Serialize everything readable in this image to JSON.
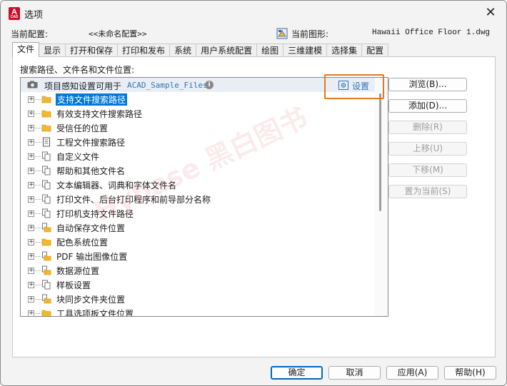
{
  "window": {
    "title": "选项",
    "close_glyph": "✕"
  },
  "app_icon": {
    "letter": "A",
    "sub": "CAD"
  },
  "profile": {
    "current_profile_label": "当前配置:",
    "current_profile_value": "<<未命名配置>>",
    "current_drawing_label": "当前图形:",
    "current_drawing_value": "Hawaii Office Floor 1.dwg"
  },
  "tabs": [
    {
      "label": "文件",
      "active": true
    },
    {
      "label": "显示"
    },
    {
      "label": "打开和保存"
    },
    {
      "label": "打印和发布"
    },
    {
      "label": "系统"
    },
    {
      "label": "用户系统配置"
    },
    {
      "label": "绘图"
    },
    {
      "label": "三维建模"
    },
    {
      "label": "选择集"
    },
    {
      "label": "配置"
    }
  ],
  "files_panel": {
    "section_label": "搜索路径、文件名和文件位置:",
    "project_header": {
      "text": "项目感知设置可用于",
      "path": "ACAD_Sample_Files",
      "info_glyph": "i",
      "settings_label": "设置"
    },
    "tree_items": [
      {
        "label": "支持文件搜索路径",
        "icon": "folder-icon",
        "selected": true
      },
      {
        "label": "有效支持文件搜索路径",
        "icon": "folder-icon"
      },
      {
        "label": "受信任的位置",
        "icon": "folder-icon"
      },
      {
        "label": "工程文件搜索路径",
        "icon": "document-icon"
      },
      {
        "label": "自定义文件",
        "icon": "files-icon"
      },
      {
        "label": "帮助和其他文件名",
        "icon": "files-icon"
      },
      {
        "label": "文本编辑器、词典和字体文件名",
        "icon": "files-icon"
      },
      {
        "label": "打印文件、后台打印程序和前导部分名称",
        "icon": "files-icon"
      },
      {
        "label": "打印机支持文件路径",
        "icon": "files-icon"
      },
      {
        "label": "自动保存文件位置",
        "icon": "folder-files-icon"
      },
      {
        "label": "配色系统位置",
        "icon": "folder-icon"
      },
      {
        "label": "PDF 输出图像位置",
        "icon": "folder-files-icon"
      },
      {
        "label": "数据源位置",
        "icon": "folder-files-icon"
      },
      {
        "label": "样板设置",
        "icon": "files-icon"
      },
      {
        "label": "块同步文件夹位置",
        "icon": "folder-files-icon"
      },
      {
        "label": "工具选项板文件位置",
        "icon": "folder-icon"
      }
    ],
    "side_buttons": [
      {
        "label": "浏览(B)...",
        "enabled": true
      },
      {
        "label": "添加(D)...",
        "enabled": true
      },
      {
        "label": "删除(R)",
        "enabled": false
      },
      {
        "label": "上移(U)",
        "enabled": false
      },
      {
        "label": "下移(M)",
        "enabled": false
      },
      {
        "label": "置为当前(S)",
        "enabled": false
      }
    ]
  },
  "footer_buttons": {
    "ok": "确定",
    "cancel": "取消",
    "apply": "应用(A)",
    "help": "帮助(H)"
  },
  "watermark": {
    "text": "Hybase 黑白图书"
  },
  "colors": {
    "accent": "#0078d7",
    "link": "#2f73b8",
    "highlight": "#e07a1f"
  }
}
